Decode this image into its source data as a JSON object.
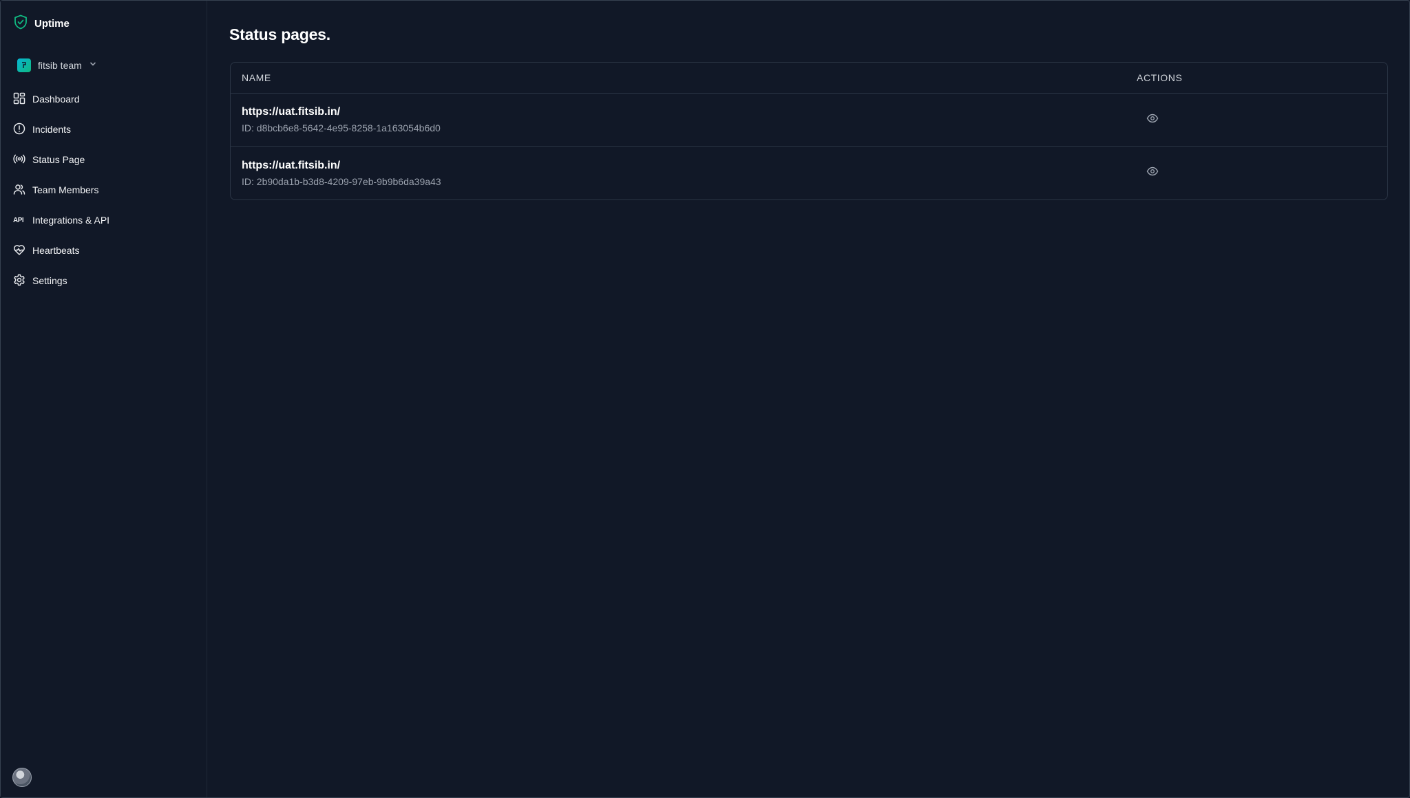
{
  "app": {
    "name": "Uptime"
  },
  "team": {
    "name": "fitsib team"
  },
  "sidebar": {
    "items": [
      {
        "label": "Dashboard"
      },
      {
        "label": "Incidents"
      },
      {
        "label": "Status Page"
      },
      {
        "label": "Team Members"
      },
      {
        "label": "Integrations & API",
        "icon_text": "API"
      },
      {
        "label": "Heartbeats"
      },
      {
        "label": "Settings"
      }
    ]
  },
  "main": {
    "title": "Status pages.",
    "table": {
      "headers": {
        "name": "NAME",
        "actions": "ACTIONS"
      },
      "rows": [
        {
          "url": "https://uat.fitsib.in/",
          "id": "ID: d8bcb6e8-5642-4e95-8258-1a163054b6d0"
        },
        {
          "url": "https://uat.fitsib.in/",
          "id": "ID: 2b90da1b-b3d8-4209-97eb-9b9b6da39a43"
        }
      ]
    }
  },
  "colors": {
    "background": "#111827",
    "brand_accent": "#10b981",
    "border": "#2b3545"
  },
  "icons": [
    "shield-check-icon",
    "chevron-down-icon",
    "dashboard-icon",
    "alert-circle-icon",
    "broadcast-icon",
    "users-icon",
    "api-icon",
    "heartbeat-icon",
    "gear-icon",
    "eye-icon"
  ]
}
